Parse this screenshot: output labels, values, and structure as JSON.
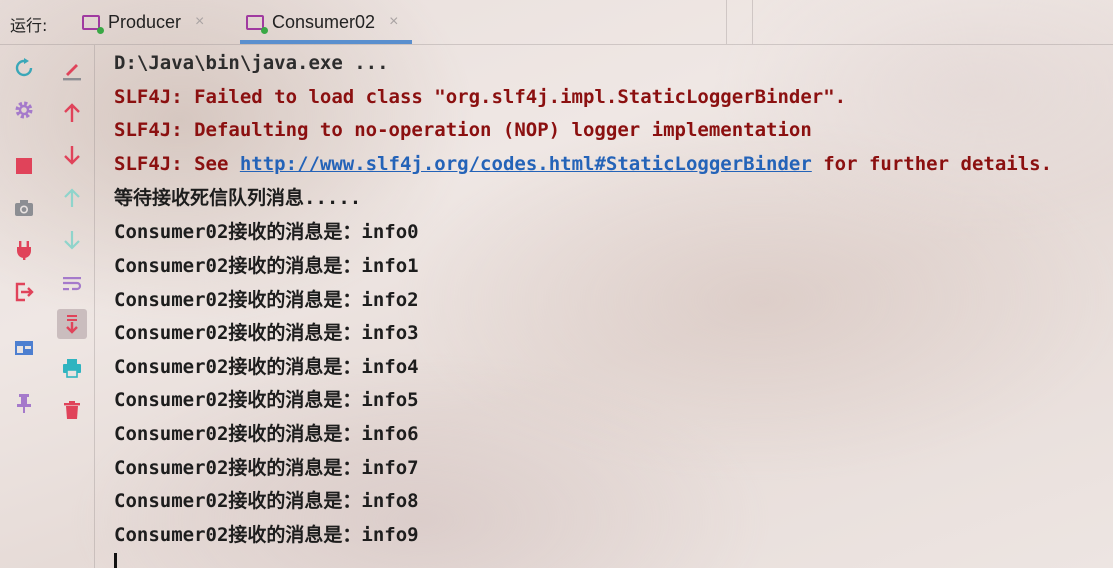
{
  "tabbar": {
    "run_label": "运行:",
    "tabs": [
      {
        "label": "Producer",
        "active": false
      },
      {
        "label": "Consumer02",
        "active": true
      }
    ],
    "close_glyph": "×"
  },
  "tools_left": [
    "rerun-icon",
    "settings-icon",
    "stop-icon",
    "camera-icon",
    "plug-icon",
    "exit-icon",
    "layout-icon",
    "pin-icon"
  ],
  "tools_right": [
    "edit-icon",
    "arrow-up-icon",
    "arrow-down-icon",
    "arrow-up-light-icon",
    "arrow-down-light-icon",
    "soft-wrap-icon",
    "scroll-to-end-icon",
    "print-icon",
    "trash-icon"
  ],
  "colors": {
    "error": "#8b1010",
    "link": "#2463b8",
    "tab_accent": "#5a8fce",
    "stop": "#e0435a"
  },
  "console": {
    "command": "D:\\Java\\bin\\java.exe ...",
    "errors": [
      "SLF4J: Failed to load class \"org.slf4j.impl.StaticLoggerBinder\".",
      "SLF4J: Defaulting to no-operation (NOP) logger implementation"
    ],
    "see_prefix": "SLF4J: See ",
    "see_link": "http://www.slf4j.org/codes.html#StaticLoggerBinder",
    "see_suffix": " for further details.",
    "waiting": "等待接收死信队列消息.....",
    "messages": [
      "Consumer02接收的消息是：info0",
      "Consumer02接收的消息是：info1",
      "Consumer02接收的消息是：info2",
      "Consumer02接收的消息是：info3",
      "Consumer02接收的消息是：info4",
      "Consumer02接收的消息是：info5",
      "Consumer02接收的消息是：info6",
      "Consumer02接收的消息是：info7",
      "Consumer02接收的消息是：info8",
      "Consumer02接收的消息是：info9"
    ]
  }
}
